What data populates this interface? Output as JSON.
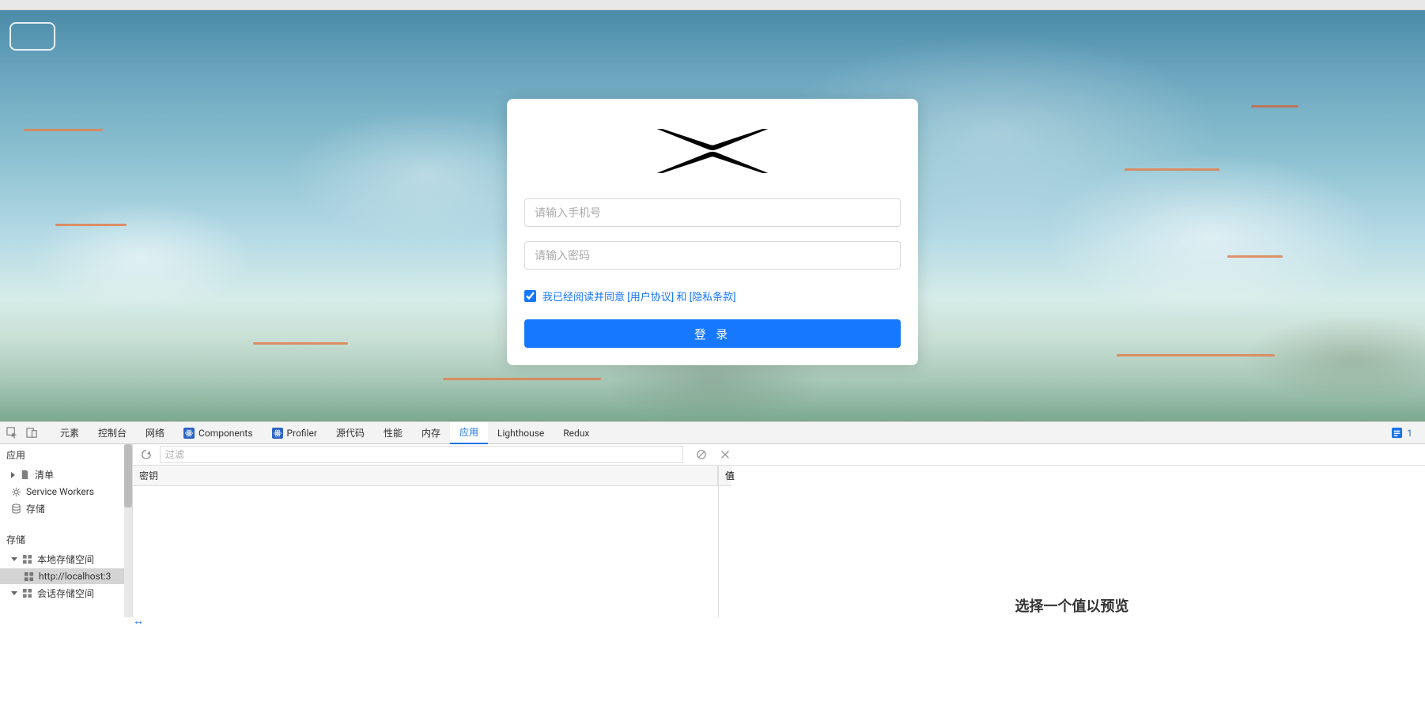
{
  "login": {
    "phone_placeholder": "请输入手机号",
    "password_placeholder": "请输入密码",
    "agree_prefix": "我已经阅读并同意",
    "user_agreement": "[用户协议]",
    "and": "和",
    "privacy_policy": "[隐私条款]",
    "login_button": "登 录"
  },
  "devtools": {
    "tabs": {
      "elements": "元素",
      "console": "控制台",
      "network": "网络",
      "components": "Components",
      "profiler": "Profiler",
      "sources": "源代码",
      "performance": "性能",
      "memory": "内存",
      "application": "应用",
      "lighthouse": "Lighthouse",
      "redux": "Redux"
    },
    "issues_count": "1",
    "side": {
      "application_title": "应用",
      "manifest": "清单",
      "service_workers": "Service Workers",
      "storage": "存储",
      "storage_title": "存储",
      "local_storage": "本地存储空间",
      "local_storage_url": "http://localhost:3",
      "session_storage": "会话存储空间"
    },
    "filter": {
      "placeholder": "过滤"
    },
    "table": {
      "key_header": "密钥",
      "value_header": "值"
    },
    "preview_hint": "选择一个值以预览"
  }
}
